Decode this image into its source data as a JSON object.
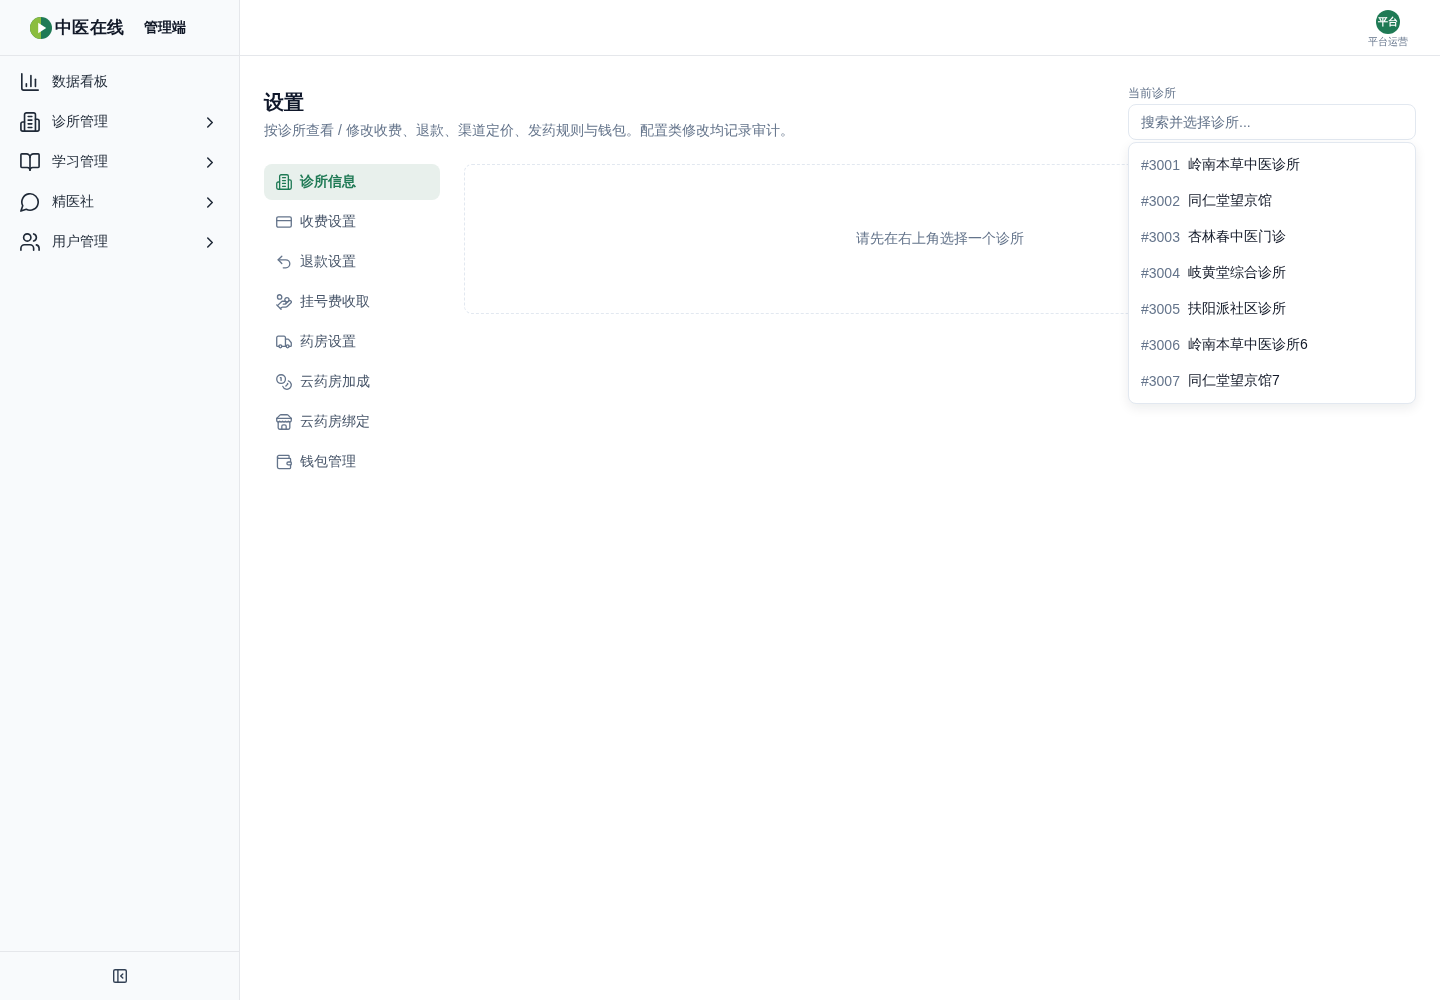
{
  "sidebar": {
    "brand": {
      "name": "中医在线",
      "suffix": "管理端"
    },
    "items": [
      {
        "label": "数据看板",
        "kind": "link"
      },
      {
        "label": "诊所管理",
        "kind": "group"
      },
      {
        "label": "学习管理",
        "kind": "group"
      },
      {
        "label": "精医社",
        "kind": "group"
      },
      {
        "label": "用户管理",
        "kind": "group"
      }
    ]
  },
  "top_bar": {
    "user": {
      "avatar_text": "平台",
      "role": "平台运营"
    }
  },
  "page": {
    "title": "设置",
    "description": "按诊所查看 / 修改收费、退款、渠道定价、发药规则与钱包。配置类修改均记录审计。"
  },
  "clinic_picker": {
    "label": "当前诊所",
    "placeholder": "搜索并选择诊所...",
    "expanded": true,
    "options": [
      {
        "id": "#3001",
        "name": "岭南本草中医诊所",
        "selected": false
      },
      {
        "id": "#3002",
        "name": "同仁堂望京馆",
        "selected": false
      },
      {
        "id": "#3003",
        "name": "杏林春中医门诊",
        "selected": false
      },
      {
        "id": "#3004",
        "name": "岐黄堂综合诊所",
        "selected": false
      },
      {
        "id": "#3005",
        "name": "扶阳派社区诊所",
        "selected": false
      },
      {
        "id": "#3006",
        "name": "岭南本草中医诊所6",
        "selected": false
      },
      {
        "id": "#3007",
        "name": "同仁堂望京馆7",
        "selected": false
      }
    ]
  },
  "settings_nav": [
    {
      "label": "诊所信息",
      "selected": true
    },
    {
      "label": "收费设置",
      "selected": false
    },
    {
      "label": "退款设置",
      "selected": false
    },
    {
      "label": "挂号费收取",
      "selected": false
    },
    {
      "label": "药房设置",
      "selected": false
    },
    {
      "label": "云药房加成",
      "selected": false
    },
    {
      "label": "云药房绑定",
      "selected": false
    },
    {
      "label": "钱包管理",
      "selected": false
    }
  ],
  "empty_state": {
    "message": "请先在右上角选择一个诊所"
  }
}
